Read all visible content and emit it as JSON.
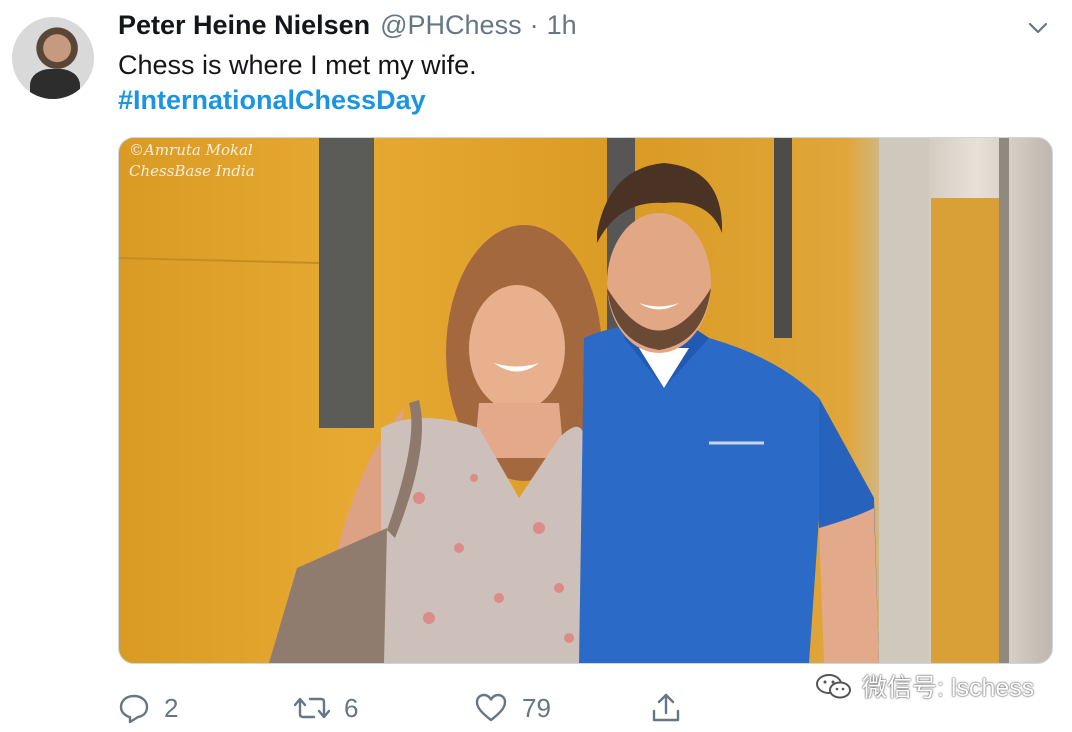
{
  "tweet": {
    "author_name": "Peter Heine Nielsen",
    "handle": "@PHChess",
    "separator": "·",
    "time": "1h",
    "text": "Chess is where I met my wife.",
    "hashtag": "#InternationalChessDay"
  },
  "media": {
    "credit_line1": "©Amruta Mokal",
    "credit_line2": "ChessBase India"
  },
  "actions": {
    "reply_count": "2",
    "retweet_count": "6",
    "like_count": "79"
  },
  "watermark": {
    "text": "微信号: lschess"
  },
  "colors": {
    "accent": "#1b95e0",
    "muted": "#657786",
    "text": "#14171a"
  }
}
